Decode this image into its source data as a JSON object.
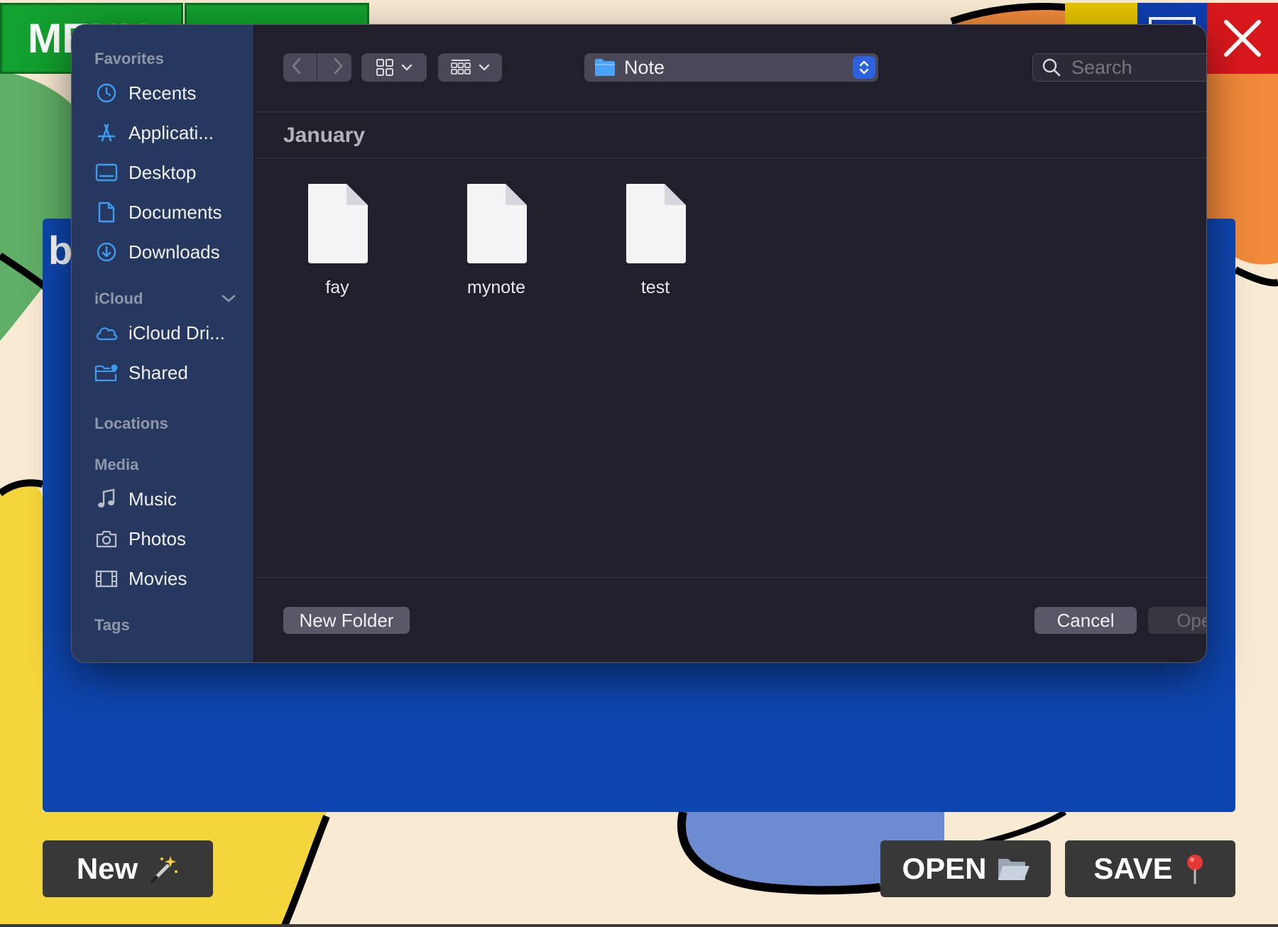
{
  "app": {
    "tab1_label": "MENU",
    "panel_letter": "b",
    "buttons": {
      "new_label": "New",
      "open_label": "OPEN",
      "save_label": "SAVE"
    },
    "colors": {
      "panel": "#0e46af",
      "tab": "#12a02e",
      "close": "#d8181c",
      "button": "#383838"
    }
  },
  "dialog": {
    "sidebar": {
      "favorites_header": "Favorites",
      "favorites": [
        {
          "label": "Recents",
          "icon": "clock-icon"
        },
        {
          "label": "Applicati...",
          "icon": "applications-icon"
        },
        {
          "label": "Desktop",
          "icon": "desktop-icon"
        },
        {
          "label": "Documents",
          "icon": "document-icon"
        },
        {
          "label": "Downloads",
          "icon": "download-icon"
        }
      ],
      "icloud_header": "iCloud",
      "icloud": [
        {
          "label": "iCloud Dri...",
          "icon": "cloud-icon"
        },
        {
          "label": "Shared",
          "icon": "shared-folder-icon"
        }
      ],
      "locations_header": "Locations",
      "media_header": "Media",
      "media": [
        {
          "label": "Music",
          "icon": "music-note-icon"
        },
        {
          "label": "Photos",
          "icon": "camera-icon"
        },
        {
          "label": "Movies",
          "icon": "film-icon"
        }
      ],
      "tags_header": "Tags"
    },
    "toolbar": {
      "location": "Note",
      "search_placeholder": "Search"
    },
    "group_header": "January",
    "files": [
      {
        "name": "fay"
      },
      {
        "name": "mynote"
      },
      {
        "name": "test"
      }
    ],
    "footer": {
      "new_folder_label": "New Folder",
      "cancel_label": "Cancel",
      "open_label": "Open"
    },
    "colors": {
      "background": "#221f2c",
      "sidebar": "#283a62",
      "accent": "#2c62e0",
      "icon_blue": "#3d9bf0"
    }
  }
}
